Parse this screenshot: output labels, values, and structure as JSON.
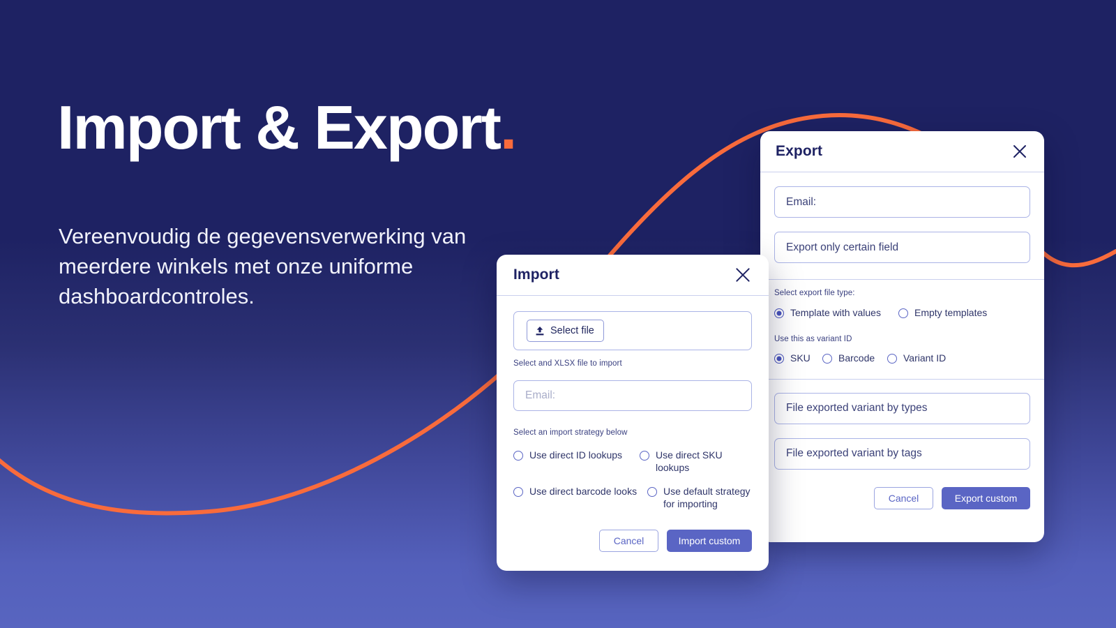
{
  "hero": {
    "title": "Import & Export",
    "title_dot": ".",
    "subtitle": "Vereenvoudig de gegevensverwerking van meerdere winkels met onze uniforme dashboardcontroles."
  },
  "colors": {
    "background_top": "#1e2263",
    "background_bottom": "#5865c0",
    "accent_orange": "#f96b3c",
    "primary_purple": "#5a65c4",
    "field_border": "#aab3e6",
    "text_navy": "#1e2263"
  },
  "import_dialog": {
    "title": "Import",
    "close_icon": "close-icon",
    "select_file": {
      "icon": "upload-icon",
      "label": "Select file"
    },
    "file_hint": "Select and XLSX file to import",
    "email_field": {
      "value": "",
      "placeholder": "Email:"
    },
    "strategy_label": "Select an import strategy below",
    "strategy_options": [
      {
        "label": "Use direct ID lookups",
        "checked": false
      },
      {
        "label": "Use direct SKU lookups",
        "checked": false
      },
      {
        "label": "Use direct barcode looks",
        "checked": false
      },
      {
        "label": "Use default strategy for importing",
        "checked": false
      }
    ],
    "cancel_label": "Cancel",
    "submit_label": "Import custom"
  },
  "export_dialog": {
    "title": "Export",
    "close_icon": "close-icon",
    "email_field": {
      "value": "Email:",
      "placeholder": "Email:"
    },
    "certain_field": {
      "value": "Export only certain field",
      "placeholder": "Export only certain field"
    },
    "file_type_label": "Select export file type:",
    "file_type_options": [
      {
        "label": "Template with values",
        "checked": true
      },
      {
        "label": "Empty templates",
        "checked": false
      }
    ],
    "variant_id_label": "Use this as variant ID",
    "variant_id_options": [
      {
        "label": "SKU",
        "checked": true
      },
      {
        "label": "Barcode",
        "checked": false
      },
      {
        "label": "Variant ID",
        "checked": false
      }
    ],
    "variant_types_field": {
      "value": "File exported variant by types"
    },
    "variant_tags_field": {
      "value": "File exported variant by tags"
    },
    "cancel_label": "Cancel",
    "submit_label": "Export custom"
  }
}
